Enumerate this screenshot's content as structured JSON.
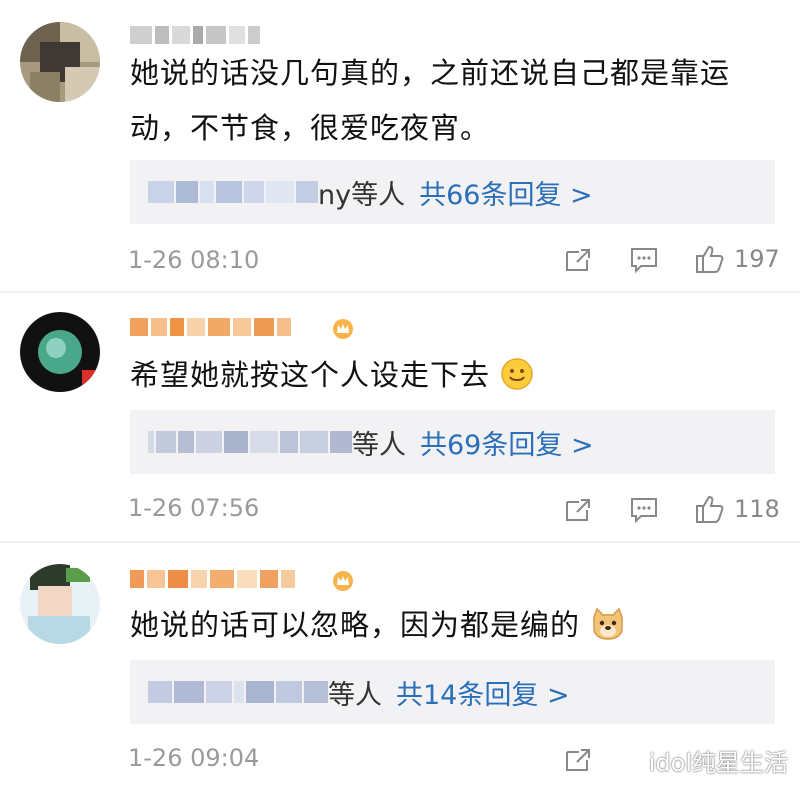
{
  "comments": [
    {
      "text": "她说的话没几句真的，之前还说自己都是靠运动，不节食，很爱吃夜宵。",
      "reply_suffix": "ny等人",
      "reply_link": "共66条回复 >",
      "time": "1-26 08:10",
      "likes": "197"
    },
    {
      "text": "希望她就按这个人设走下去",
      "reply_suffix": "等人",
      "reply_link": "共69条回复 >",
      "time": "1-26 07:56",
      "likes": "118"
    },
    {
      "text": "她说的话可以忽略，因为都是编的",
      "reply_suffix": "等人",
      "reply_link": "共14条回复 >",
      "time": "1-26 09:04",
      "likes": ""
    }
  ],
  "icons": {
    "share": "share-icon",
    "comment": "comment-icon",
    "like": "thumbs-up-icon",
    "smile": "smile-emoji-icon",
    "doge": "doge-emoji-icon",
    "crown": "crown-badge-icon",
    "wechat": "wechat-icon"
  },
  "watermark": "idol纯星生活",
  "colors": {
    "link": "#2b6fb8",
    "meta": "#9a9a9a",
    "reply_bg": "#f2f2f4"
  }
}
